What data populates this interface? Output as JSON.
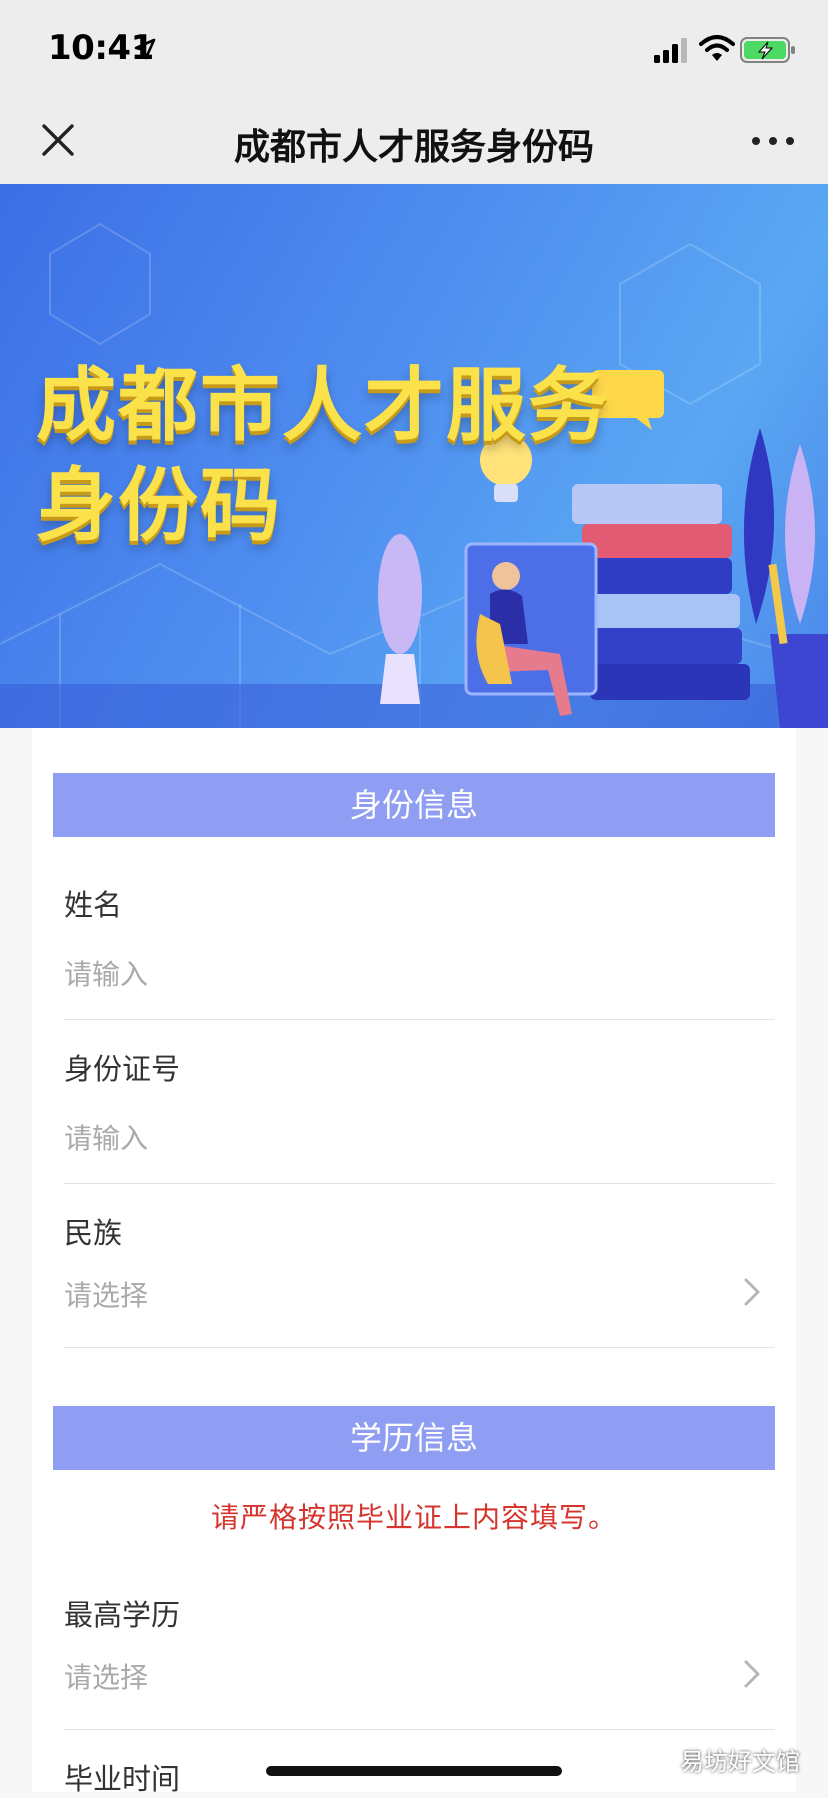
{
  "status_bar": {
    "time": "10:41"
  },
  "nav": {
    "title": "成都市人才服务身份码"
  },
  "banner": {
    "title_line1": "成都市人才服务",
    "title_line2": "身份码"
  },
  "identity_section": {
    "header": "身份信息",
    "name": {
      "label": "姓名",
      "placeholder": "请输入"
    },
    "id_number": {
      "label": "身份证号",
      "placeholder": "请输入"
    },
    "ethnicity": {
      "label": "民族",
      "placeholder": "请选择"
    }
  },
  "education_section": {
    "header": "学历信息",
    "notice": "请严格按照毕业证上内容填写。",
    "highest_degree": {
      "label": "最高学历",
      "placeholder": "请选择"
    },
    "graduation_time": {
      "label": "毕业时间"
    }
  },
  "watermark": "易坊好文馆",
  "colors": {
    "section_header_bg": "#8f9ef2",
    "notice_text": "#d5352d",
    "banner_title": "#fbe14a",
    "battery_green": "#4cd964"
  },
  "icons": [
    "location-arrow-icon",
    "signal-icon",
    "wifi-icon",
    "battery-charging-icon",
    "close-icon",
    "more-icon",
    "chevron-right-icon"
  ]
}
